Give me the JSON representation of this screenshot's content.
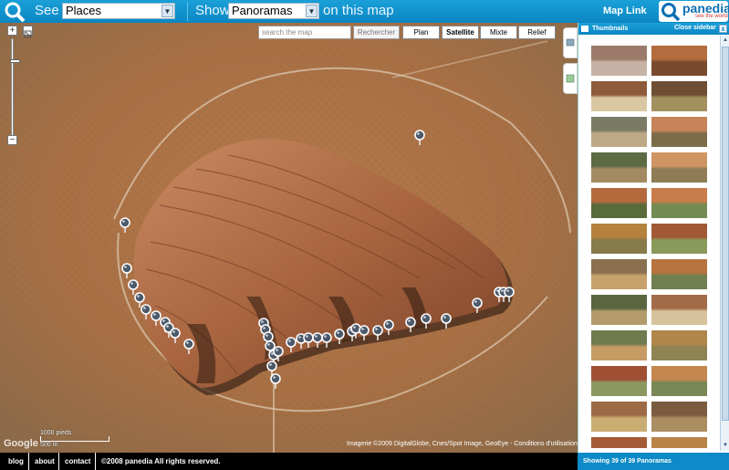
{
  "topbar": {
    "see_label": "See",
    "see_value": "Places",
    "show_label": "Show",
    "show_value": "Panoramas",
    "on_map_label": "on this map",
    "map_link": "Map Link",
    "logo_text": "panedia",
    "logo_tagline": "see the world"
  },
  "map": {
    "search_placeholder": "search the map",
    "search_button": "Rechercher",
    "types": [
      "Plan",
      "Satellite",
      "Mixte",
      "Relief"
    ],
    "active_type": "Satellite",
    "scale_top": "1000 pieds",
    "scale_bottom": "500 m",
    "google_logo": "Google",
    "copyright": "Imagerie ©2009 DigitalGlobe, Cnes/Spot Image, GeoEye - Conditions d'utilisation"
  },
  "sidebar": {
    "title": "Thumbnails",
    "close_label": "Close sidebar",
    "close_x": "x",
    "status": "Showing 39 of 39 Panoramas"
  },
  "footer": {
    "links": [
      "blog",
      "about",
      "contact"
    ],
    "copyright": "©2008 panedia All rights reserved."
  }
}
